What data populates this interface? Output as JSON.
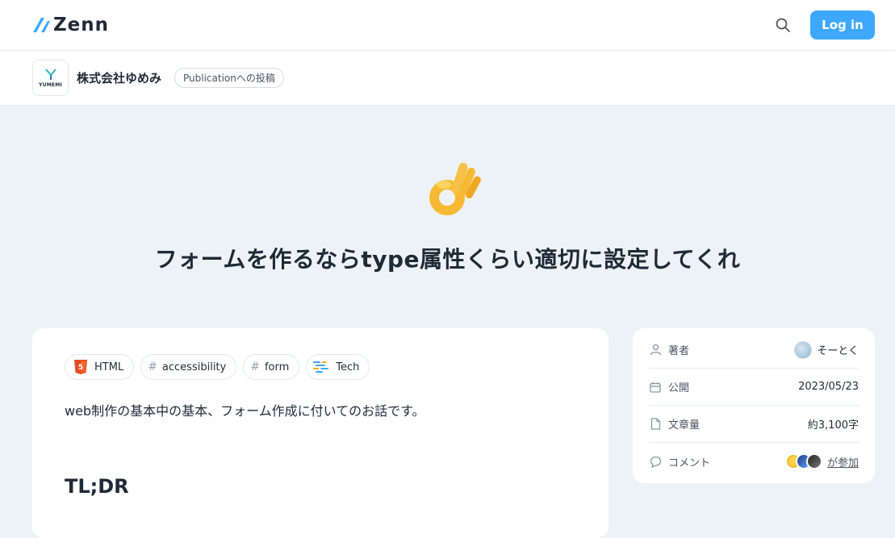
{
  "header": {
    "logo_text": "Zenn",
    "login_label": "Log in"
  },
  "publication": {
    "logo_text": "YUMEMI",
    "name": "株式会社ゆめみ",
    "badge": "Publicationへの投稿"
  },
  "article": {
    "emoji": "ok-hand",
    "title": "フォームを作るならtype属性くらい適切に設定してくれ",
    "tags": [
      {
        "label": "HTML",
        "icon": "html5-icon"
      },
      {
        "label": "accessibility",
        "icon": "hash"
      },
      {
        "label": "form",
        "icon": "hash"
      },
      {
        "label": "Tech",
        "icon": "tech-icon"
      }
    ],
    "intro": "web制作の基本中の基本、フォーム作成に付いてのお話です。",
    "heading": "TL;DR"
  },
  "sidebar": {
    "author_label": "著者",
    "author_name": "そーとく",
    "published_label": "公開",
    "published_date": "2023/05/23",
    "length_label": "文章量",
    "length_value": "約3,100字",
    "comment_label": "コメント",
    "comment_value": "が参加"
  },
  "colors": {
    "accent": "#3ea8ff",
    "background": "#edf2f7",
    "text": "#1f2a37"
  }
}
